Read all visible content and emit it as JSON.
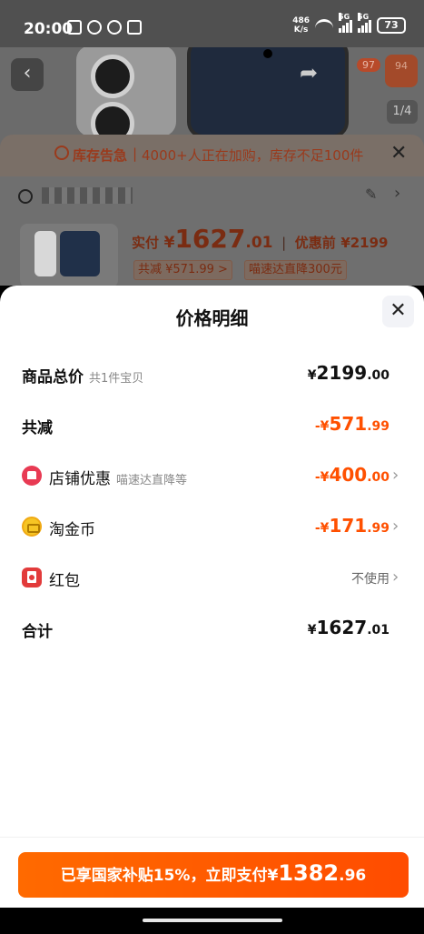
{
  "status_bar": {
    "time": "20:00",
    "net_speed_value": "486",
    "net_speed_unit": "K/s",
    "signal_1": "5G",
    "signal_2": "5G",
    "battery": "73"
  },
  "background_page": {
    "cart_badge": "97",
    "more_badge": "94",
    "image_index": "1/4",
    "stock_alert": {
      "title": "库存告急",
      "separator": "|",
      "text": "4000+人正在加购，库存不足100件"
    },
    "product": {
      "paid_label": "实付",
      "currency": "¥",
      "paid_int": "1627",
      "paid_dec": ".01",
      "separator": "|",
      "orig_label": "优惠前",
      "orig_price": "¥2199",
      "tag_discount": "共减 ¥571.99 >",
      "tag_promo": "喵速达直降300元"
    }
  },
  "sheet": {
    "title": "价格明细",
    "rows": [
      {
        "label": "商品总价",
        "sub": "共1件宝贝",
        "sym": "¥",
        "int": "2199",
        "dec": ".00"
      },
      {
        "label": "共减",
        "sub": "",
        "sym": "-¥",
        "int": "571",
        "dec": ".99"
      },
      {
        "label": "店铺优惠",
        "sub": "喵速达直降等",
        "sym": "-¥",
        "int": "400",
        "dec": ".00",
        "icon": "store-icon"
      },
      {
        "label": "淘金币",
        "sub": "",
        "sym": "-¥",
        "int": "171",
        "dec": ".99",
        "icon": "coin-icon"
      },
      {
        "label": "红包",
        "sub": "",
        "value_text": "不使用",
        "icon": "red-packet-icon"
      },
      {
        "label": "合计",
        "sub": "",
        "sym": "¥",
        "int": "1627",
        "dec": ".01"
      }
    ],
    "pay_button": {
      "text": "已享国家补贴15%，立即支付",
      "sym": "¥",
      "int": "1382",
      "dec": ".96"
    }
  },
  "colors": {
    "accent": "#ff5000",
    "button": "#ff5a00",
    "text_primary": "#111111",
    "text_secondary": "#888888"
  }
}
